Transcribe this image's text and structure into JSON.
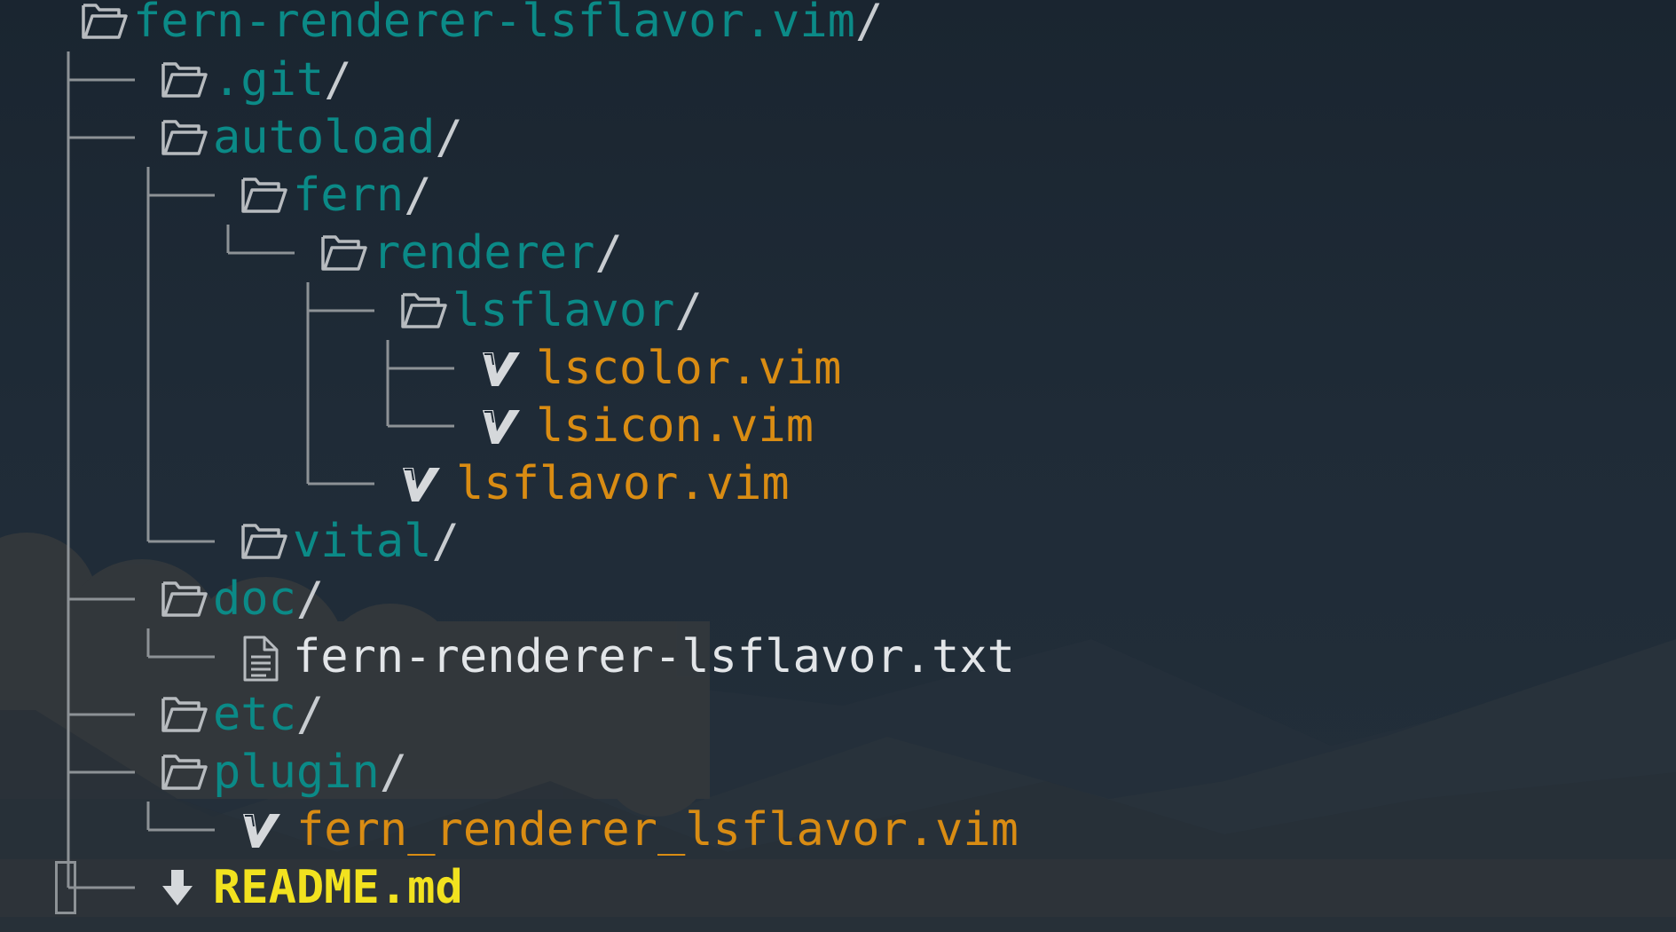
{
  "tree": {
    "root": {
      "name": "fern-renderer-lsflavor.vim",
      "suffix": "/"
    },
    "rows": [
      {
        "name": ".git",
        "suffix": "/"
      },
      {
        "name": "autoload",
        "suffix": "/"
      },
      {
        "name": "fern",
        "suffix": "/"
      },
      {
        "name": "renderer",
        "suffix": "/"
      },
      {
        "name": "lsflavor",
        "suffix": "/"
      },
      {
        "name": "lscolor.vim",
        "suffix": ""
      },
      {
        "name": "lsicon.vim",
        "suffix": ""
      },
      {
        "name": "lsflavor.vim",
        "suffix": ""
      },
      {
        "name": "vital",
        "suffix": "/"
      },
      {
        "name": "doc",
        "suffix": "/"
      },
      {
        "name": "fern-renderer-lsflavor.txt",
        "suffix": ""
      },
      {
        "name": "etc",
        "suffix": "/"
      },
      {
        "name": "plugin",
        "suffix": "/"
      },
      {
        "name": "fern_renderer_lsflavor.vim",
        "suffix": ""
      },
      {
        "name": "README.md",
        "suffix": ""
      }
    ]
  },
  "icons": {
    "folder": "folder-open-icon",
    "vim": "vim-icon",
    "text": "text-file-icon",
    "markdown": "download-arrow-icon"
  },
  "colors": {
    "directory": "#0b8a87",
    "vim_file": "#d98c13",
    "text_file": "#e2e5e8",
    "readme": "#f2e21f",
    "tree_lines": "#8d9296"
  }
}
